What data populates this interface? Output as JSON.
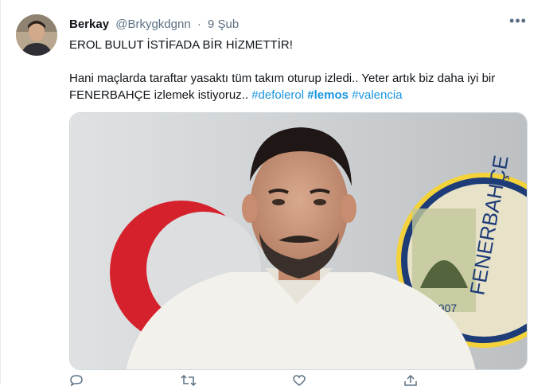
{
  "tweet": {
    "author_name": "Berkay",
    "handle": "@Brkygkdgnn",
    "separator": "·",
    "date": "9 Şub",
    "more_label": "•••",
    "line1": "EROL BULUT İSTİFADA BİR HİZMETTİR!",
    "line2_part1": "Hani maçlarda taraftar yasaktı tüm takım oturup izledi.. Yeter artık biz daha iyi bir FENERBAHÇE izlemek istiyoruz.. ",
    "hashtags": [
      "#defolerol",
      "#lemos",
      "#valencia"
    ],
    "image_badge_text": "FENERBAHÇE",
    "image_emblem_text": "1907"
  },
  "colors": {
    "link": "#1b95e0",
    "secondary_text": "#5b7083",
    "border": "#e6ecf0"
  },
  "actions": [
    "reply-icon",
    "retweet-icon",
    "like-icon",
    "share-icon"
  ]
}
